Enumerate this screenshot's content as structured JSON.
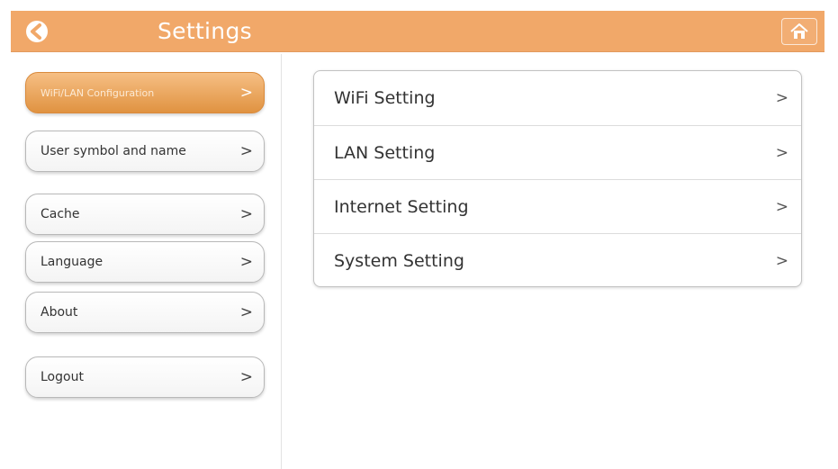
{
  "header": {
    "title": "Settings",
    "back_icon": "back-arrow-icon",
    "home_icon": "home-icon",
    "accent_color": "#f1a869"
  },
  "sidebar": {
    "items": [
      {
        "label": "WiFi/LAN Configuration",
        "chevron": ">",
        "active": true
      },
      {
        "label": "User symbol and name",
        "chevron": ">",
        "active": false
      },
      {
        "label": "Cache",
        "chevron": ">",
        "active": false
      },
      {
        "label": "Language",
        "chevron": ">",
        "active": false
      },
      {
        "label": "About",
        "chevron": ">",
        "active": false
      },
      {
        "label": "Logout",
        "chevron": ">",
        "active": false
      }
    ]
  },
  "main": {
    "items": [
      {
        "label": "WiFi Setting",
        "chevron": ">"
      },
      {
        "label": "LAN Setting",
        "chevron": ">"
      },
      {
        "label": "Internet Setting",
        "chevron": ">"
      },
      {
        "label": "System Setting",
        "chevron": ">"
      }
    ]
  }
}
